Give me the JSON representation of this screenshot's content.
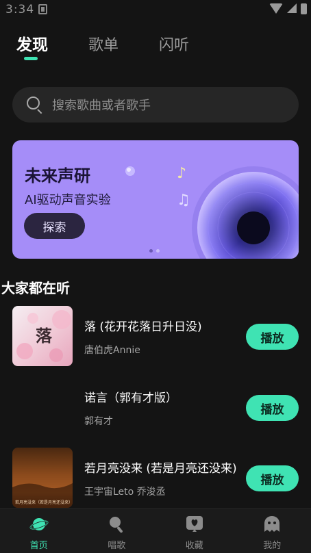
{
  "status_bar": {
    "time": "3:34"
  },
  "tabs": [
    {
      "label": "发现"
    },
    {
      "label": "歌单"
    },
    {
      "label": "闪听"
    }
  ],
  "search": {
    "placeholder": "搜索歌曲或者歌手"
  },
  "banner": {
    "title": "未来声研",
    "subtitle": "AI驱动声音实验",
    "button_label": "探索"
  },
  "section": {
    "title": "大家都在听"
  },
  "songs": [
    {
      "title": "落 (花开花落日升日没)",
      "artist": "唐伯虎Annie",
      "button": "播放",
      "cover_text": "落"
    },
    {
      "title": "诺言（郭有才版）",
      "artist": "郭有才",
      "button": "播放",
      "cover_text": ""
    },
    {
      "title": "若月亮没来 (若是月亮还没来)",
      "artist": "王宇宙Leto 乔浚丞",
      "button": "播放",
      "cover_text": "若月亮没来（若是月亮还没来）"
    }
  ],
  "bottom_nav": [
    {
      "label": "首页",
      "icon": "planet-icon"
    },
    {
      "label": "唱歌",
      "icon": "microphone-icon"
    },
    {
      "label": "收藏",
      "icon": "heart-box-icon"
    },
    {
      "label": "我的",
      "icon": "ghost-icon"
    }
  ],
  "colors": {
    "accent": "#3fe3b3",
    "banner": "#a58df8",
    "background": "#141414"
  }
}
